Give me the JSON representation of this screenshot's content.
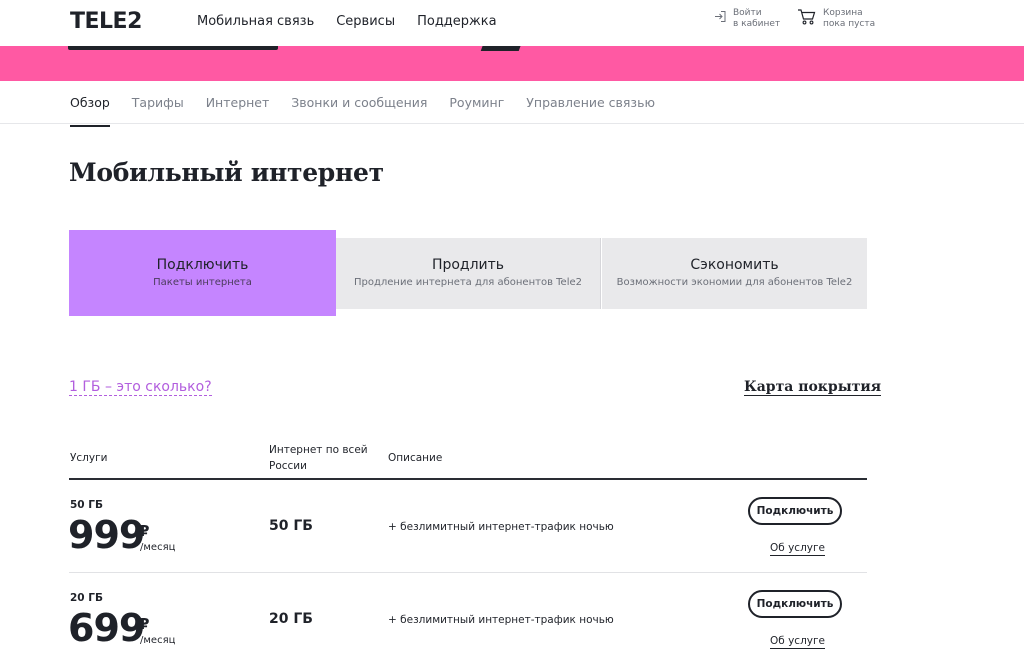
{
  "header": {
    "logo": "TELE2",
    "nav": [
      "Мобильная связь",
      "Сервисы",
      "Поддержка"
    ],
    "login": {
      "line1": "Войти",
      "line2": "в кабинет"
    },
    "cart": {
      "line1": "Корзина",
      "line2": "пока пуста"
    }
  },
  "colors": {
    "banner": "#ff59a3",
    "accent_purple": "#c585ff",
    "link_purple": "#b25ede",
    "text_dark": "#1f2229"
  },
  "subnav": {
    "tabs": [
      "Обзор",
      "Тарифы",
      "Интернет",
      "Звонки и сообщения",
      "Роуминг",
      "Управление связью"
    ],
    "active": "Обзор"
  },
  "page": {
    "title": "Мобильный интернет"
  },
  "segments": [
    {
      "title": "Подключить",
      "subtitle": "Пакеты интернета",
      "active": true
    },
    {
      "title": "Продлить",
      "subtitle": "Продление интернета для абонентов Tele2",
      "active": false
    },
    {
      "title": "Сэкономить",
      "subtitle": "Возможности экономии для абонентов Tele2",
      "active": false
    }
  ],
  "links": {
    "gb_question": "1 ГБ – это сколько?",
    "coverage_map": "Карта покрытия"
  },
  "table": {
    "headers": {
      "services": "Услуги",
      "internet": "Интернет по всей России",
      "description": "Описание"
    },
    "rows": [
      {
        "volume_small": "50 ГБ",
        "price": "999",
        "currency": "₽",
        "period": "/месяц",
        "volume": "50 ГБ",
        "description": "+ безлимитный интернет-трафик ночью",
        "button": "Подключить",
        "about": "Об услуге"
      },
      {
        "volume_small": "20 ГБ",
        "price": "699",
        "currency": "₽",
        "period": "/месяц",
        "volume": "20 ГБ",
        "description": "+ безлимитный интернет-трафик ночью",
        "button": "Подключить",
        "about": "Об услуге"
      }
    ]
  }
}
